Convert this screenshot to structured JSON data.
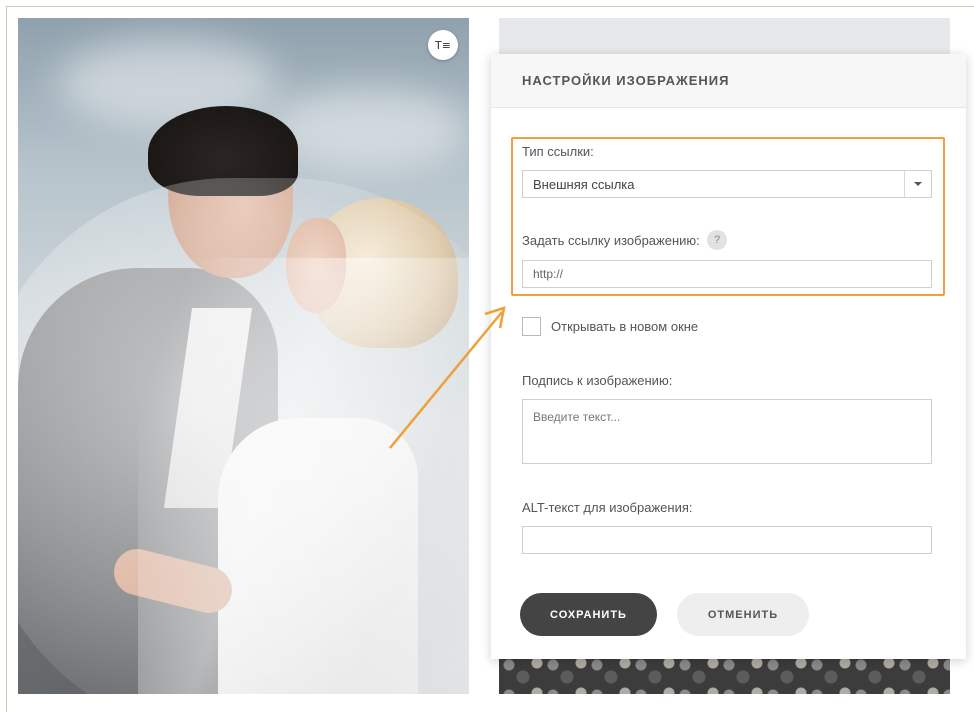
{
  "panel": {
    "title": "НАСТРОЙКИ ИЗОБРАЖЕНИЯ",
    "link_type": {
      "label": "Тип ссылки:",
      "selected": "Внешняя ссылка"
    },
    "image_link": {
      "label": "Задать ссылку изображению:",
      "help": "?",
      "value": "http://"
    },
    "new_window": {
      "label": "Открывать в новом окне",
      "checked": false
    },
    "caption": {
      "label": "Подпись к изображению:",
      "placeholder": "Введите текст..."
    },
    "alt_text": {
      "label": "ALT-текст для изображения:",
      "value": ""
    },
    "buttons": {
      "save": "СОХРАНИТЬ",
      "cancel": "ОТМЕНИТЬ"
    }
  },
  "photo_button": {
    "icon": "text-settings-icon",
    "glyph": "T≡"
  },
  "colors": {
    "highlight": "#eea03a",
    "save_button": "#444444",
    "cancel_button": "#eeeeee"
  }
}
